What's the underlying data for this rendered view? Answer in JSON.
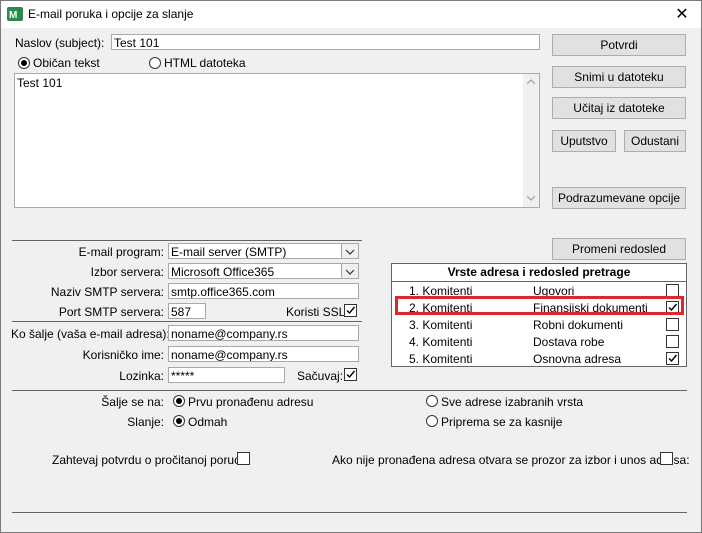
{
  "window": {
    "title": "E-mail poruka i opcije za slanje",
    "close_glyph": "✕",
    "icon": "app-icon"
  },
  "subject": {
    "label": "Naslov (subject):",
    "value": "Test 101"
  },
  "format": {
    "plain_label": "Običan tekst",
    "html_label": "HTML datoteka",
    "selected": "plain"
  },
  "body_text": "Test 101",
  "buttons": {
    "confirm": "Potvrdi",
    "save_file": "Snimi u datoteku",
    "load_file": "Učitaj iz datoteke",
    "help": "Uputstvo",
    "cancel": "Odustani",
    "defaults": "Podrazumevane opcije",
    "reorder": "Promeni redosled"
  },
  "server": {
    "program_label": "E-mail program:",
    "program_value": "E-mail server (SMTP)",
    "choice_label": "Izbor servera:",
    "choice_value": "Microsoft Office365",
    "smtp_name_label": "Naziv SMTP servera:",
    "smtp_name_value": "smtp.office365.com",
    "port_label": "Port SMTP servera:",
    "port_value": "587",
    "ssl_label": "Koristi SSL:",
    "ssl_checked": true
  },
  "sender": {
    "from_label": "Ko šalje (vaša e-mail adresa):",
    "from_value": "noname@company.rs",
    "user_label": "Korisničko ime:",
    "user_value": "noname@company.rs",
    "password_label": "Lozinka:",
    "password_value": "*****",
    "save_label": "Sačuvaj:",
    "save_checked": true
  },
  "address_table": {
    "title": "Vrste adresa i redosled pretrage",
    "rows": [
      {
        "c1": "1. Komitenti",
        "c2": "Ugovori",
        "checked": false
      },
      {
        "c1": "2. Komitenti",
        "c2": "Finansijski dokumenti",
        "checked": true
      },
      {
        "c1": "3. Komitenti",
        "c2": "Robni dokumenti",
        "checked": false
      },
      {
        "c1": "4. Komitenti",
        "c2": "Dostava robe",
        "checked": false
      },
      {
        "c1": "5. Komitenti",
        "c2": "Osnovna adresa",
        "checked": true
      }
    ],
    "highlight_color": "#e0262b"
  },
  "send_to": {
    "label": "Šalje se na:",
    "opt1": "Prvu pronađenu adresu",
    "opt2": "Sve adrese izabranih vrsta",
    "selected": "opt1"
  },
  "sending": {
    "label": "Slanje:",
    "opt1": "Odmah",
    "opt2": "Priprema se za kasnije",
    "selected": "opt1"
  },
  "read_receipt": {
    "label": "Zahtevaj potvrdu o pročitanoj poruci:",
    "checked": false
  },
  "prompt_on_missing": {
    "label": "Ako nije pronađena adresa otvara se prozor za izbor i unos adresa:",
    "checked": false
  }
}
